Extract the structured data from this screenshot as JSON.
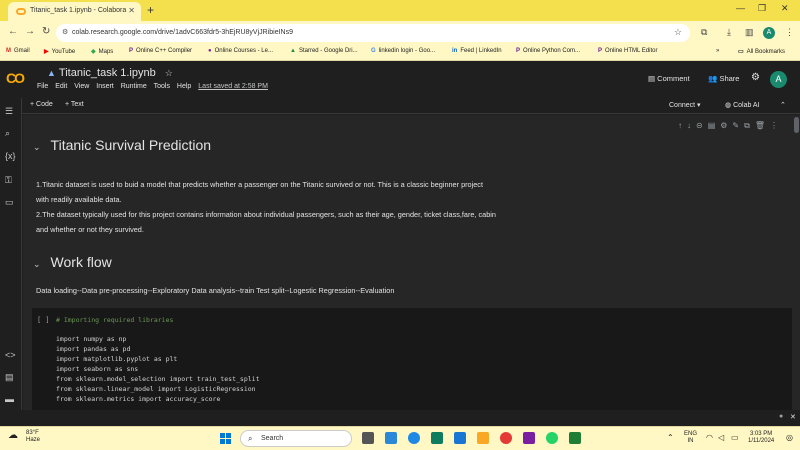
{
  "browser": {
    "tab_title": "Titanic_task 1.ipynb - Colabora",
    "new_tab": "+",
    "url": "colab.research.google.com/drive/1advC663fdr5-3hEjRU8yVjJRibieINs9",
    "profile_initial": "A"
  },
  "bookmarks": [
    {
      "icon": "M",
      "label": "Gmail"
    },
    {
      "icon": "▶",
      "label": "YouTube"
    },
    {
      "icon": "◆",
      "label": "Maps"
    },
    {
      "icon": "P",
      "label": "Online C++ Compiler"
    },
    {
      "icon": "●",
      "label": "Online Courses - Le..."
    },
    {
      "icon": "▲",
      "label": "Starred - Google Dri..."
    },
    {
      "icon": "G",
      "label": "linkedin login - Goo..."
    },
    {
      "icon": "in",
      "label": "Feed | LinkedIn"
    },
    {
      "icon": "P",
      "label": "Online Python Com..."
    },
    {
      "icon": "P",
      "label": "Online HTML Editor"
    }
  ],
  "all_bookmarks": "All Bookmarks",
  "colab": {
    "logo": "CO",
    "notebook_title": "Titanic_task 1.ipynb",
    "menus": [
      "File",
      "Edit",
      "View",
      "Insert",
      "Runtime",
      "Tools",
      "Help"
    ],
    "last_saved": "Last saved at 2:58 PM",
    "comment": "Comment",
    "share": "Share",
    "avatar": "A",
    "add_code": "+ Code",
    "add_text": "+ Text",
    "connect": "Connect",
    "colab_ai": "Colab AI"
  },
  "notebook": {
    "heading1": "Titanic Survival Prediction",
    "para1_line1": "1.Titanic dataset is used to buid a model that predicts whether a passenger on the Titanic survived or not. This is a classic beginner project",
    "para1_line2": "with readily available data.",
    "para2_line1": "2.The dataset typically used for this project contains information about individual passengers, such as their age, gender, ticket class,fare, cabin",
    "para2_line2": "and whether or not they survived.",
    "heading2": "Work flow",
    "workflow": "Data loading--Data pre-processing--Exploratory Data analysis--train Test split--Logestic Regression--Evaluation",
    "run_indicator": "[ ]",
    "code_comment": "# Importing required libraries",
    "code_lines": [
      "import numpy as np",
      "import pandas as pd",
      "import matplotlib.pyplot as plt",
      "import seaborn as sns",
      "from sklearn.model_selection import train_test_split",
      "from sklearn.linear_model import LogisticRegression",
      "from sklearn.metrics import accuracy_score"
    ]
  },
  "taskbar": {
    "temp": "83°F",
    "condition": "Haze",
    "search": "Search",
    "lang1": "ENG",
    "lang2": "IN",
    "time": "3:03 PM",
    "date": "1/11/2024"
  }
}
